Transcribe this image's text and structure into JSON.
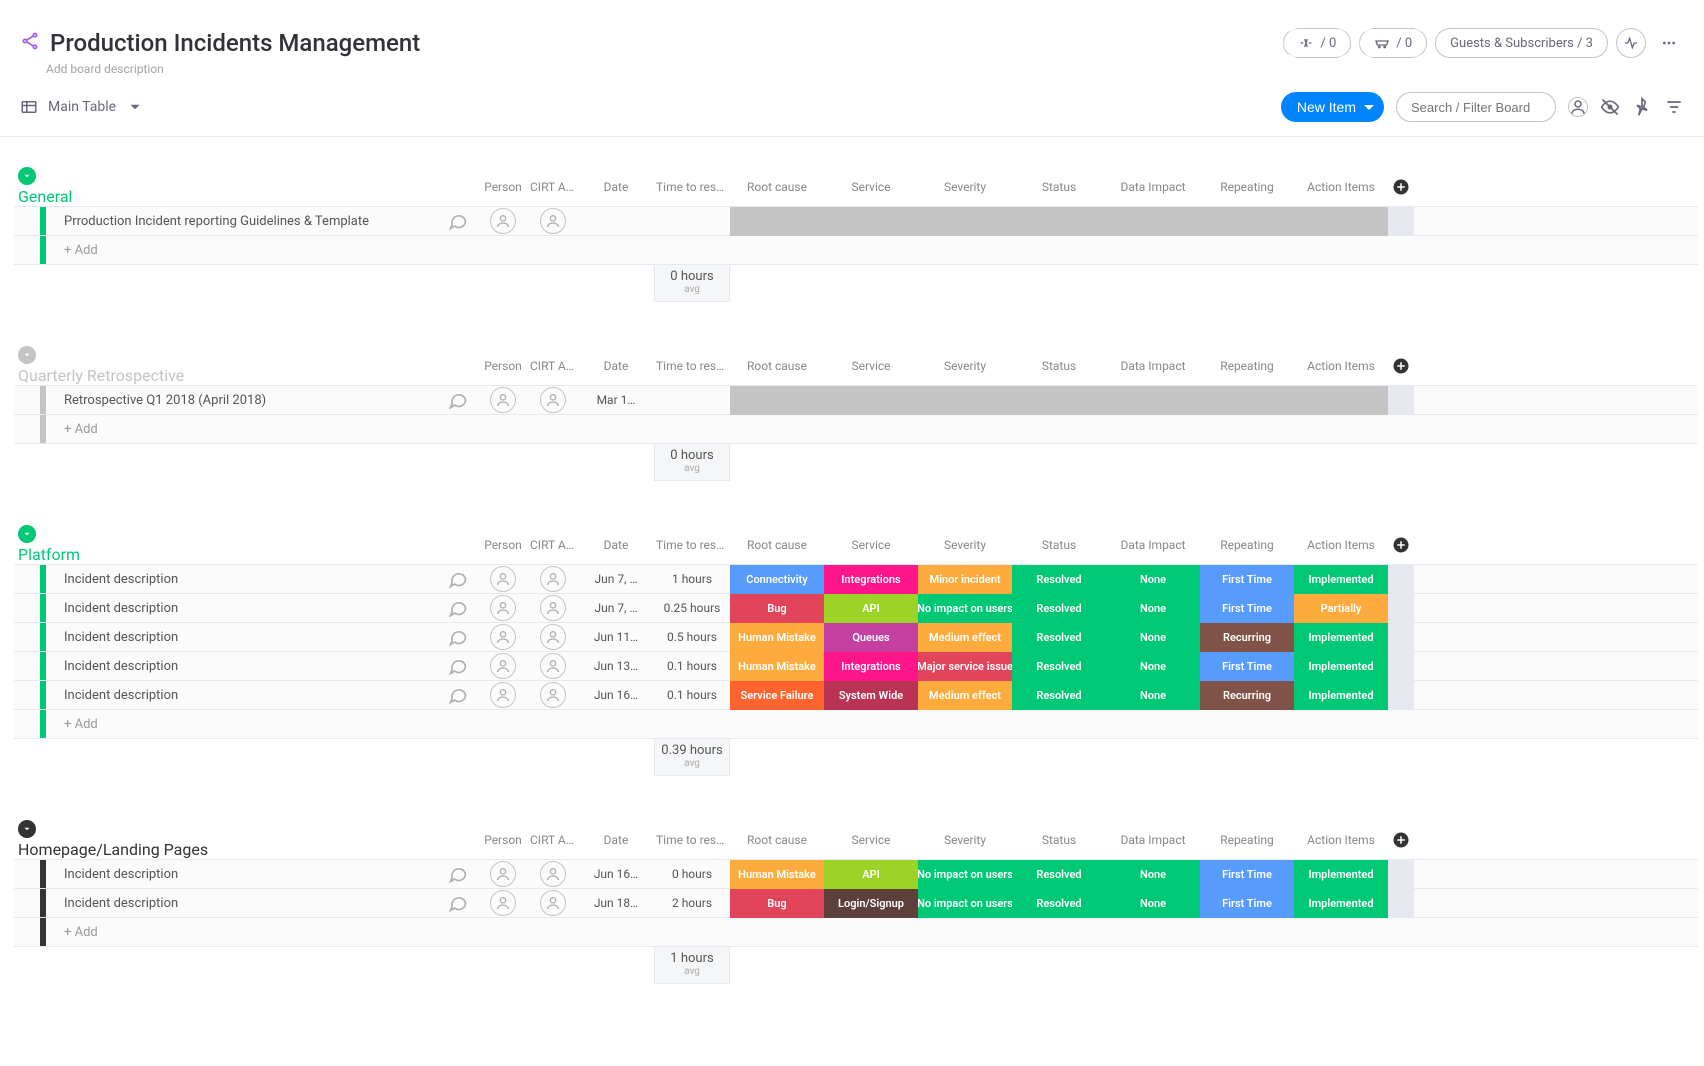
{
  "header": {
    "title": "Production Incidents Management",
    "desc": "Add board description",
    "recycle_count": "/ 0",
    "cart_count": "/ 0",
    "guests_label": "Guests & Subscribers / 3"
  },
  "toolbar": {
    "main_view": "Main Table",
    "new_item": "New Item",
    "search_placeholder": "Search / Filter Board"
  },
  "columns": [
    "Person",
    "CIRT As…",
    "Date",
    "Time to reso…",
    "Root cause",
    "Service",
    "Severity",
    "Status",
    "Data Impact",
    "Repeating",
    "Action Items"
  ],
  "add_row_label": "+ Add",
  "summary_avg_label": "avg",
  "groups": [
    {
      "title": "General",
      "color": "#00c875",
      "summary_time": "0 hours",
      "rows": [
        {
          "name": "Prroduction Incident reporting Guidelines & Template",
          "date": "",
          "time": "",
          "status_blank": true
        }
      ]
    },
    {
      "title": "Quarterly Retrospective",
      "color": "#c4c4c4",
      "summary_time": "0 hours",
      "rows": [
        {
          "name": "Retrospective Q1 2018 (April 2018)",
          "date": "Mar 1…",
          "time": "",
          "status_blank": true
        }
      ]
    },
    {
      "title": "Platform",
      "color": "#00c875",
      "summary_time": "0.39 hours",
      "rows": [
        {
          "name": "Incident description",
          "date": "Jun 7, …",
          "time": "1 hours",
          "cells": [
            {
              "t": "Connectivity",
              "c": "c-blue"
            },
            {
              "t": "Integrations",
              "c": "c-pink"
            },
            {
              "t": "Minor incident",
              "c": "c-orange"
            },
            {
              "t": "Resolved",
              "c": "c-green"
            },
            {
              "t": "None",
              "c": "c-green"
            },
            {
              "t": "First Time",
              "c": "c-blue"
            },
            {
              "t": "Implemented",
              "c": "c-green"
            }
          ]
        },
        {
          "name": "Incident description",
          "date": "Jun 7, …",
          "time": "0.25 hours",
          "cells": [
            {
              "t": "Bug",
              "c": "c-red"
            },
            {
              "t": "API",
              "c": "c-lime"
            },
            {
              "t": "No impact on users",
              "c": "c-green"
            },
            {
              "t": "Resolved",
              "c": "c-green"
            },
            {
              "t": "None",
              "c": "c-green"
            },
            {
              "t": "First Time",
              "c": "c-blue"
            },
            {
              "t": "Partially",
              "c": "c-orange"
            }
          ]
        },
        {
          "name": "Incident description",
          "date": "Jun 11…",
          "time": "0.5 hours",
          "cells": [
            {
              "t": "Human Mistake",
              "c": "c-orange"
            },
            {
              "t": "Queues",
              "c": "c-magenta"
            },
            {
              "t": "Medium effect",
              "c": "c-orange"
            },
            {
              "t": "Resolved",
              "c": "c-green"
            },
            {
              "t": "None",
              "c": "c-green"
            },
            {
              "t": "Recurring",
              "c": "c-brown"
            },
            {
              "t": "Implemented",
              "c": "c-green"
            }
          ]
        },
        {
          "name": "Incident description",
          "date": "Jun 13…",
          "time": "0.1 hours",
          "cells": [
            {
              "t": "Human Mistake",
              "c": "c-orange"
            },
            {
              "t": "Integrations",
              "c": "c-pink"
            },
            {
              "t": "Major service issue",
              "c": "c-red"
            },
            {
              "t": "Resolved",
              "c": "c-green"
            },
            {
              "t": "None",
              "c": "c-green"
            },
            {
              "t": "First Time",
              "c": "c-blue"
            },
            {
              "t": "Implemented",
              "c": "c-green"
            }
          ]
        },
        {
          "name": "Incident description",
          "date": "Jun 16…",
          "time": "0.1 hours",
          "cells": [
            {
              "t": "Service Failure",
              "c": "c-orangeD"
            },
            {
              "t": "System Wide",
              "c": "c-crimson"
            },
            {
              "t": "Medium effect",
              "c": "c-orange"
            },
            {
              "t": "Resolved",
              "c": "c-green"
            },
            {
              "t": "None",
              "c": "c-green"
            },
            {
              "t": "Recurring",
              "c": "c-brown"
            },
            {
              "t": "Implemented",
              "c": "c-green"
            }
          ]
        }
      ]
    },
    {
      "title": "Homepage/Landing Pages",
      "color": "#333333",
      "summary_time": "1 hours",
      "rows": [
        {
          "name": "Incident description",
          "date": "Jun 16…",
          "time": "0 hours",
          "cells": [
            {
              "t": "Human Mistake",
              "c": "c-orange"
            },
            {
              "t": "API",
              "c": "c-lime"
            },
            {
              "t": "No impact on users",
              "c": "c-green"
            },
            {
              "t": "Resolved",
              "c": "c-green"
            },
            {
              "t": "None",
              "c": "c-green"
            },
            {
              "t": "First Time",
              "c": "c-blue"
            },
            {
              "t": "Implemented",
              "c": "c-green"
            }
          ]
        },
        {
          "name": "Incident description",
          "date": "Jun 18…",
          "time": "2 hours",
          "cells": [
            {
              "t": "Bug",
              "c": "c-red"
            },
            {
              "t": "Login/Signup",
              "c": "c-darkbr"
            },
            {
              "t": "No impact on users",
              "c": "c-green"
            },
            {
              "t": "Resolved",
              "c": "c-green"
            },
            {
              "t": "None",
              "c": "c-green"
            },
            {
              "t": "First Time",
              "c": "c-blue"
            },
            {
              "t": "Implemented",
              "c": "c-green"
            }
          ]
        }
      ]
    }
  ]
}
